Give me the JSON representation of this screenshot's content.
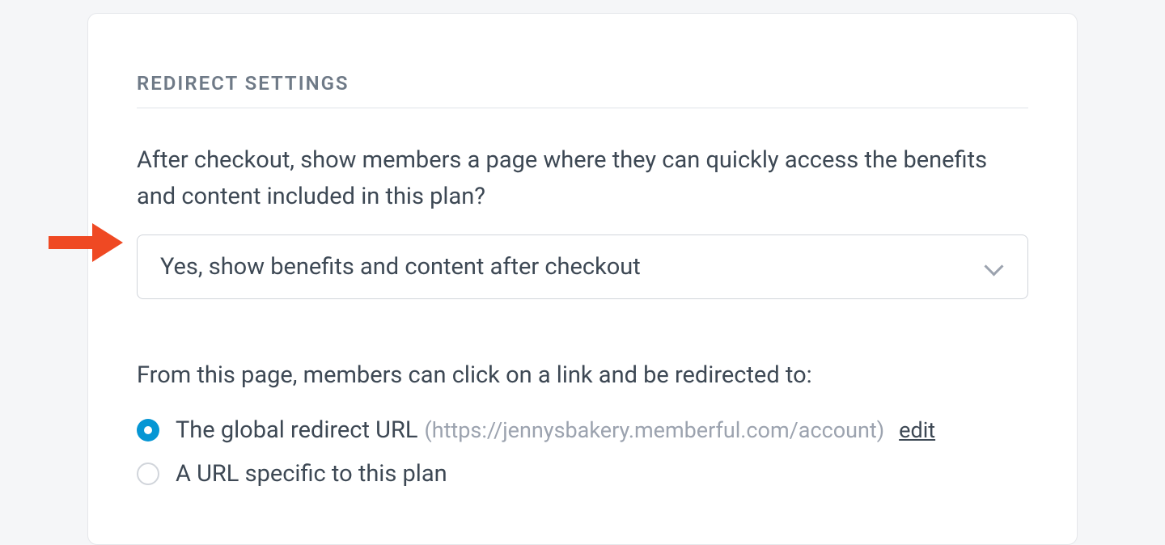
{
  "card": {
    "heading": "REDIRECT SETTINGS",
    "description": "After checkout, show members a page where they can quickly access the benefits and content included in this plan?",
    "dropdown": {
      "selected": "Yes, show benefits and content after checkout"
    },
    "sub_description": "From this page, members can click on a link and be redirected to:",
    "radio_options": [
      {
        "label": "The global redirect URL",
        "url": "(https://jennysbakery.memberful.com/account)",
        "edit_label": "edit",
        "selected": true
      },
      {
        "label": "A URL specific to this plan",
        "selected": false
      }
    ]
  },
  "colors": {
    "accent": "#0596d4",
    "annotation": "#ef4923"
  }
}
